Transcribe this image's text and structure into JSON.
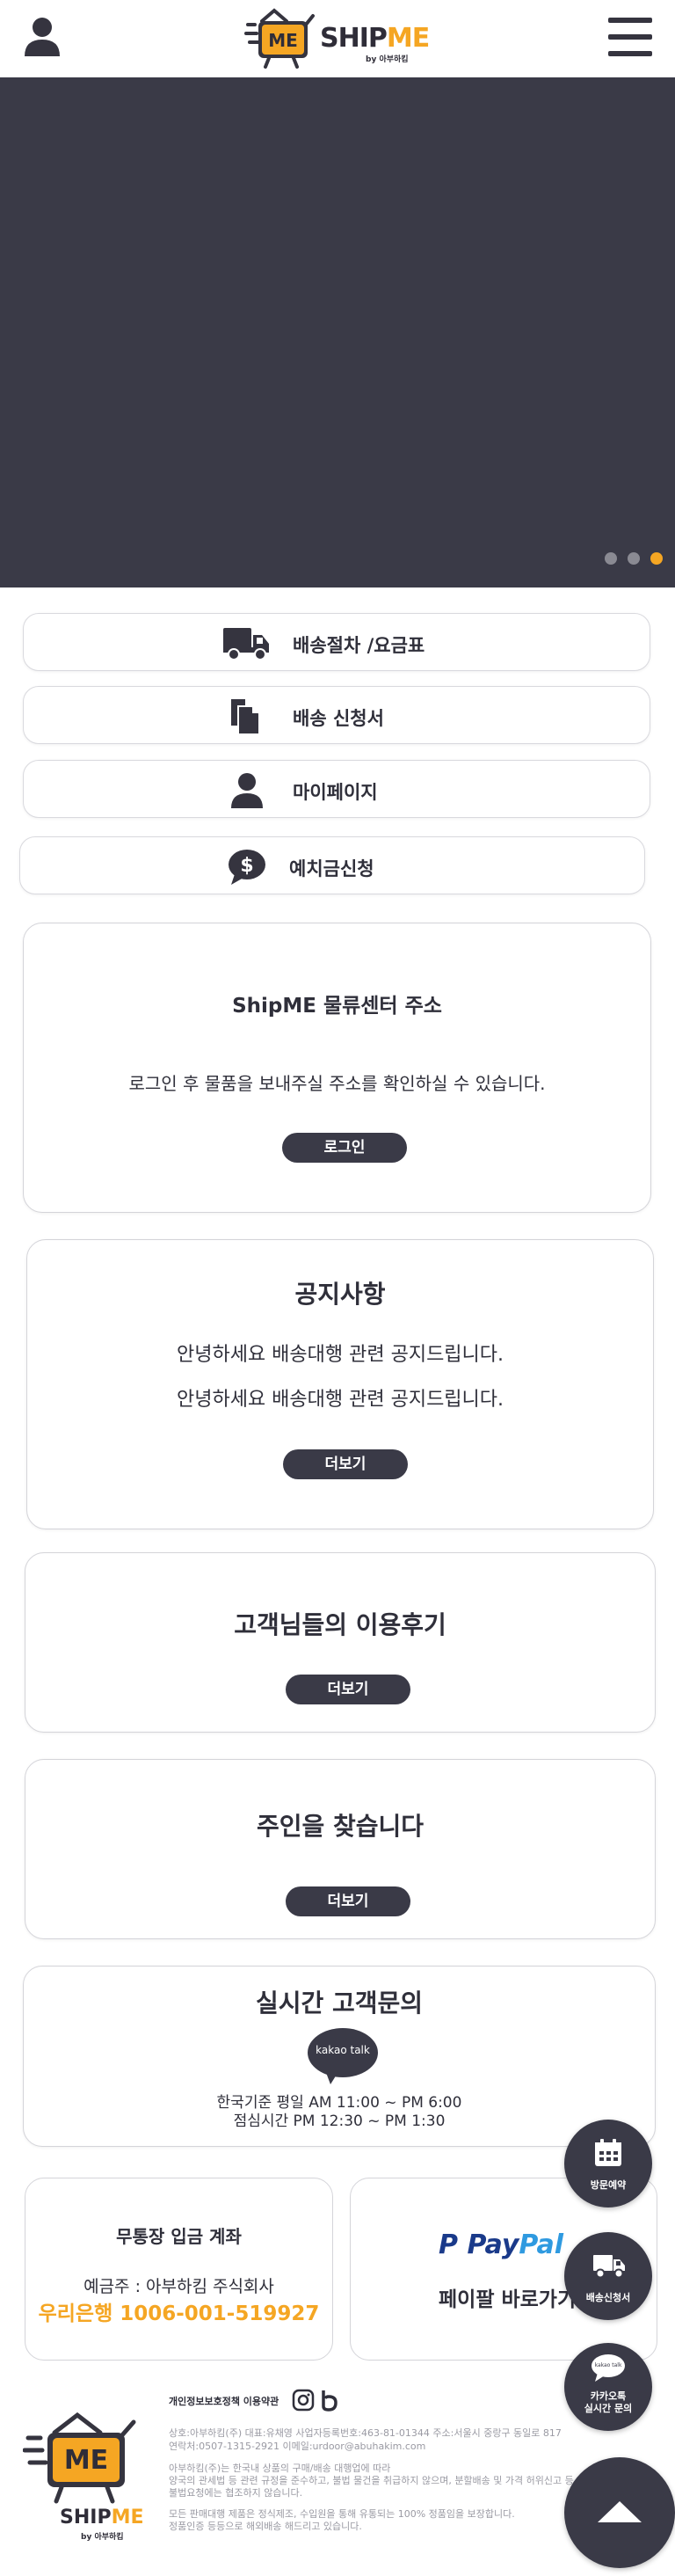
{
  "header": {
    "logo_word_dark": "SHIP",
    "logo_word_accent": "ME",
    "logo_badge": "ME",
    "logo_by": "by 아부하킴",
    "user_icon": "user-icon",
    "menu_icon": "hamburger-menu-icon"
  },
  "banner": {
    "slide_count": 3,
    "active_slide": 3
  },
  "quick_menu": [
    {
      "label": "배송절차 /요금표",
      "icon": "truck-icon"
    },
    {
      "label": "배송 신청서",
      "icon": "documents-icon"
    },
    {
      "label": "마이페이지",
      "icon": "user-icon"
    },
    {
      "label": "예치금신청",
      "icon": "dollar-bubble-icon"
    }
  ],
  "address_card": {
    "title": "ShipME 물류센터 주소",
    "text": "로그인 후 물품을 보내주실 주소를 확인하실 수 있습니다.",
    "button": "로그인"
  },
  "notice_card": {
    "title": "공지사항",
    "items": [
      "안녕하세요 배송대행 관련 공지드립니다.",
      "안녕하세요 배송대행 관련 공지드립니다."
    ],
    "button": "더보기"
  },
  "review_card": {
    "title": "고객님들의 이용후기",
    "button": "더보기"
  },
  "lost_card": {
    "title": "주인을 찾습니다",
    "button": "더보기"
  },
  "inquiry_card": {
    "title": "실시간 고객문의",
    "kakao_label": "kakao talk",
    "hours_line1": "한국기준 평일 AM 11:00 ~ PM 6:00",
    "hours_line2": "점심시간 PM 12:30 ~ PM 1:30"
  },
  "bank_card": {
    "title": "무통장 입금 계좌",
    "holder": "예금주 : 아부하킴 주식회사",
    "account": "우리은행 1006-001-519927"
  },
  "paypal_card": {
    "logo_p": "P",
    "logo_pay": "Pay",
    "logo_pal": "Pal",
    "label": "페이팔 바로가기"
  },
  "floating": {
    "visit": "방문예약",
    "shipping_form": "배송신청서",
    "kakao_line1": "카카오톡",
    "kakao_line2": "실시간 문의",
    "kakao_small": "kakao talk",
    "top_icon": "arrow-up-icon"
  },
  "footer": {
    "logo_badge": "ME",
    "logo_word_dark": "SHIP",
    "logo_word_accent": "ME",
    "logo_by": "by 아부하킴",
    "links": "개인정보보호정책 이용약관",
    "social": [
      "instagram-icon",
      "blog-icon"
    ],
    "line1": "상호:아부하킴(주)      대표:유채영      사업자등록번호:463-81-01344      주소:서울시 중랑구 동일로 817",
    "line2": "연락처:0507-1315-2921      이메일:urdoor@abuhakim.com",
    "line3": "아부하킴(주)는 한국내 상품의 구매/배송 대행업에 따라",
    "line4": "양국의 관세법 등 관련 규정을 준수하고, 불법 물건을 취급하지 않으며, 분할배송 및 가격 허위신고 등",
    "line5": "불법요청에는 협조하지 않습니다.",
    "line6": "모든 판매대행 제품은 정식제조, 수입원을 통해 유통되는 100% 정품임을 보장합니다.",
    "line7": "정품인증 등등으로 해외배송 해드리고 있습니다."
  },
  "colors": {
    "accent": "#f5a623",
    "dark": "#3a3a47",
    "paypal_dark": "#1a3a8a",
    "paypal_light": "#2f9ae0"
  }
}
